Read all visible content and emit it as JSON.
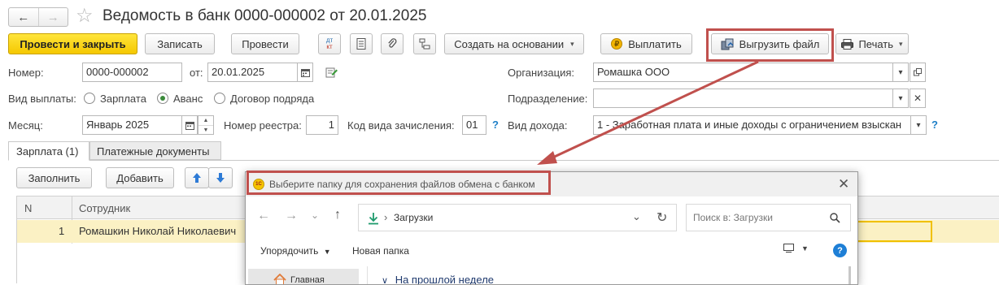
{
  "header": {
    "title": "Ведомость в банк 0000-000002 от 20.01.2025",
    "back_glyph": "←",
    "forward_glyph": "→",
    "star_glyph": "☆"
  },
  "toolbar": {
    "post_close": "Провести и закрыть",
    "save": "Записать",
    "post": "Провести",
    "dtkt_top": "дт",
    "dtkt_bottom": "кт",
    "create_based": "Создать на основании",
    "pay": "Выплатить",
    "upload_file": "Выгрузить файл",
    "print": "Печать"
  },
  "form": {
    "number_label": "Номер:",
    "number_value": "0000-000002",
    "date_label": "от:",
    "date_value": "20.01.2025",
    "org_label": "Организация:",
    "org_value": "Ромашка ООО",
    "payout_label": "Вид выплаты:",
    "payout_options": [
      "Зарплата",
      "Аванс",
      "Договор подряда"
    ],
    "payout_selected": "Аванс",
    "division_label": "Подразделение:",
    "division_value": "",
    "month_label": "Месяц:",
    "month_value": "Январь 2025",
    "registry_label": "Номер реестра:",
    "registry_value": "1",
    "accrual_code_label": "Код вида зачисления:",
    "accrual_code_value": "01",
    "income_label": "Вид дохода:",
    "income_value": "1 - Заработная плата и иные доходы с ограничением взыскан",
    "help": "?"
  },
  "tabs": [
    {
      "label": "Зарплата (1)",
      "active": true
    },
    {
      "label": "Платежные документы",
      "active": false
    }
  ],
  "table_toolbar": {
    "fill": "Заполнить",
    "add": "Добавить"
  },
  "table": {
    "columns": [
      "N",
      "Сотрудник"
    ],
    "rows": [
      {
        "n": "1",
        "employee": "Ромашкин Николай Николаевич"
      }
    ]
  },
  "dialog": {
    "title": "Выберите папку для сохранения файлов обмена с банком",
    "path_item": "Загрузки",
    "search_placeholder": "Поиск в: Загрузки",
    "organize": "Упорядочить",
    "new_folder": "Новая папка",
    "nav_home": "Главная",
    "group_header": "На прошлой неделе"
  },
  "colors": {
    "accent_yellow": "#f5c800",
    "highlight_box": "#c0504d",
    "selected_row": "#fbf1c4",
    "help_blue": "#1e7fc7"
  }
}
